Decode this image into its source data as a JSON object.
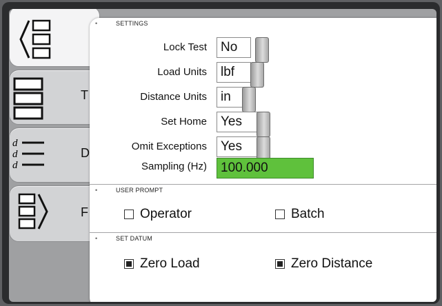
{
  "settings": {
    "header": "SETTINGS",
    "rows": [
      {
        "label": "Lock Test",
        "value": "No"
      },
      {
        "label": "Load Units",
        "value": "lbf"
      },
      {
        "label": "Distance Units",
        "value": "in"
      },
      {
        "label": "Set Home",
        "value": "Yes"
      },
      {
        "label": "Omit Exceptions",
        "value": "Yes"
      }
    ],
    "sampling_label": "Sampling (Hz)",
    "sampling_value": "100.000",
    "sampling_color": "#5fc13c"
  },
  "user_prompt": {
    "header": "USER PROMPT",
    "operator_label": "Operator",
    "operator_checked": false,
    "batch_label": "Batch",
    "batch_checked": false
  },
  "set_datum": {
    "header": "SET DATUM",
    "zero_load_label": "Zero Load",
    "zero_load_checked": true,
    "zero_distance_label": "Zero Distance",
    "zero_distance_checked": true
  },
  "tabs": {
    "tab2_letter": "T",
    "tab3_letter": "D",
    "tab4_letter": "F",
    "d_glyph": "d"
  },
  "icons": [
    "back-stack-icon",
    "stack-icon",
    "distance-list-icon",
    "forward-stack-icon"
  ]
}
